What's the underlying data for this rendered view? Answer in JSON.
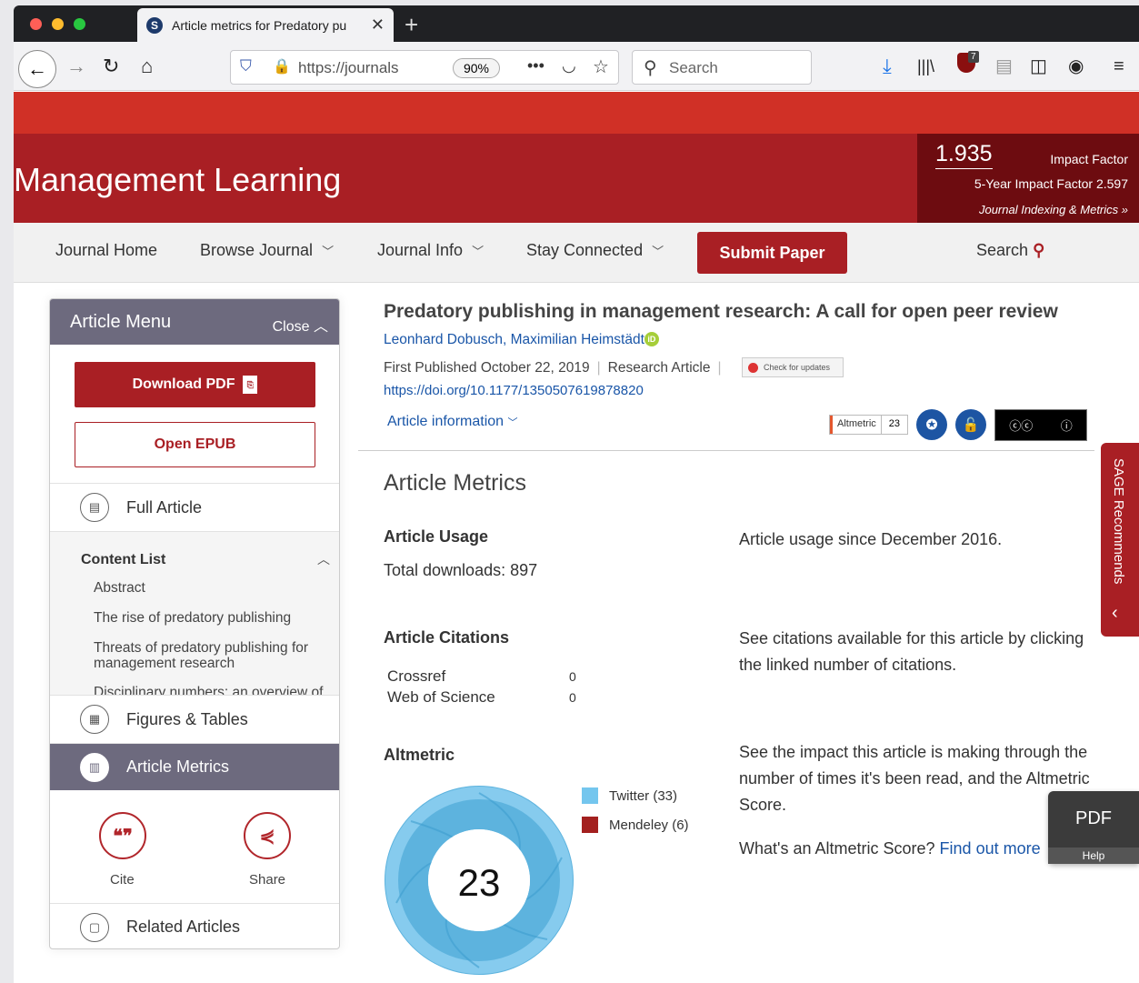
{
  "browser": {
    "tab_title": "Article metrics for Predatory pu",
    "url": "https://journals",
    "zoom": "90%",
    "search_placeholder": "Search",
    "notification_count": "7"
  },
  "journal": {
    "title": "Management Learning",
    "impact_factor": "1.935",
    "impact_label": "Impact Factor",
    "five_year": "5-Year Impact Factor 2.597",
    "indexing_link": "Journal Indexing & Metrics »"
  },
  "nav": {
    "home": "Journal Home",
    "browse": "Browse Journal",
    "info": "Journal Info",
    "connected": "Stay Connected",
    "submit": "Submit Paper",
    "search": "Search"
  },
  "sidebar": {
    "title": "Article Menu",
    "close": "Close",
    "download_pdf": "Download PDF",
    "open_epub": "Open EPUB",
    "full_article": "Full Article",
    "content_list_title": "Content List",
    "content_items": [
      "Abstract",
      "The rise of predatory publishing",
      "Threats of predatory publishing for management research",
      "Disciplinary numbers: an overview of"
    ],
    "figures_tables": "Figures & Tables",
    "article_metrics": "Article Metrics",
    "cite": "Cite",
    "share": "Share",
    "related": "Related Articles"
  },
  "article": {
    "title": "Predatory publishing in management research: A call for open peer review",
    "authors": "Leonhard Dobusch, Maximilian Heimstädt",
    "first_published": "First Published October 22, 2019",
    "type": "Research Article",
    "check_updates": "Check for updates",
    "doi": "https://doi.org/10.1177/1350507619878820",
    "info_link": "Article information",
    "altmetric_label": "Altmetric",
    "altmetric_score": "23"
  },
  "metrics": {
    "heading": "Article Metrics",
    "usage_heading": "Article Usage",
    "total_downloads": "Total downloads: 897",
    "usage_note": "Article usage since December 2016.",
    "citations_heading": "Article Citations",
    "citations_note": "See citations available for this article by clicking the linked number of citations.",
    "citations": [
      {
        "source": "Crossref",
        "count": "0"
      },
      {
        "source": "Web of Science",
        "count": "0"
      }
    ],
    "altmetric_heading": "Altmetric",
    "altmetric_note": "See the impact this article is making through the number of times it's been read, and the Altmetric Score.",
    "score_question": "What's an Altmetric Score?",
    "find_out": "Find out more",
    "donut_score": "23",
    "legend": [
      {
        "label": "Twitter (33)",
        "color": "#74c6ee"
      },
      {
        "label": "Mendeley (6)",
        "color": "#a3201f"
      }
    ]
  },
  "floaters": {
    "sage": "SAGE Recommends",
    "pdf": "PDF",
    "help": "Help"
  }
}
